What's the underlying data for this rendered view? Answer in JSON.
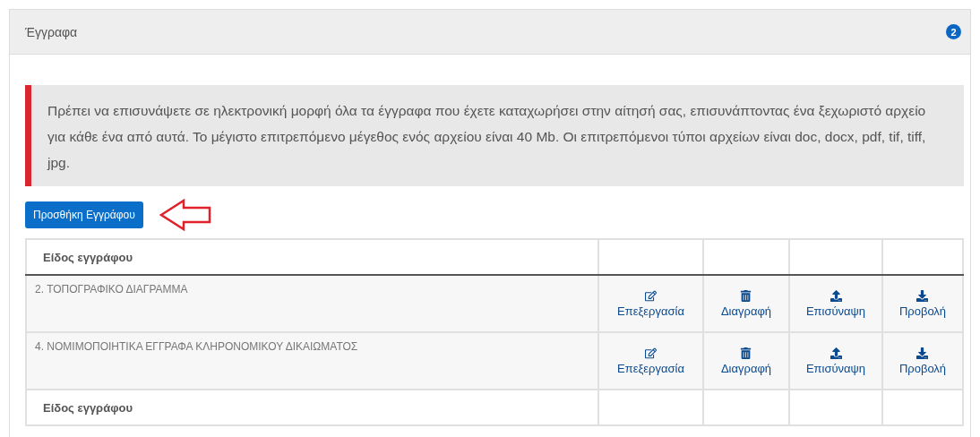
{
  "panel": {
    "title": "Έγγραφα",
    "badge": "2"
  },
  "alert": "Πρέπει να επισυνάψετε σε ηλεκτρονική μορφή όλα τα έγγραφα που έχετε καταχωρήσει στην αίτησή σας, επισυνάπτοντας ένα ξεχωριστό αρχείο για κάθε ένα από αυτά. Το μέγιστο επιτρεπόμενο μέγεθος ενός αρχείου είναι 40 Mb. Οι επιτρεπόμενοι τύποι αρχείων είναι doc, docx, pdf, tif, tiff, jpg.",
  "add_button": "Προσθήκη Εγγράφου",
  "table": {
    "header": "Είδος εγγράφου",
    "rows": [
      {
        "name": "2. ΤΟΠΟΓΡΑΦΙΚΟ ΔΙΑΓΡΑΜΜΑ",
        "actions": [
          {
            "kind": "edit",
            "label": "Επεξεργασία"
          },
          {
            "kind": "delete",
            "label": "Διαγραφή"
          },
          {
            "kind": "attach",
            "label": "Επισύναψη"
          },
          {
            "kind": "view",
            "label": "Προβολή"
          }
        ]
      },
      {
        "name": "4. ΝΟΜΙΜΟΠΟΙΗΤΙΚΑ ΕΓΓΡΑΦΑ ΚΛΗΡΟΝΟΜΙΚΟΥ ΔΙΚΑΙΩΜΑΤΟΣ",
        "actions": [
          {
            "kind": "edit",
            "label": "Επεξεργασία"
          },
          {
            "kind": "delete",
            "label": "Διαγραφή"
          },
          {
            "kind": "attach",
            "label": "Επισύναψη"
          },
          {
            "kind": "view",
            "label": "Προβολή"
          }
        ]
      }
    ],
    "footer": "Είδος εγγράφου"
  }
}
